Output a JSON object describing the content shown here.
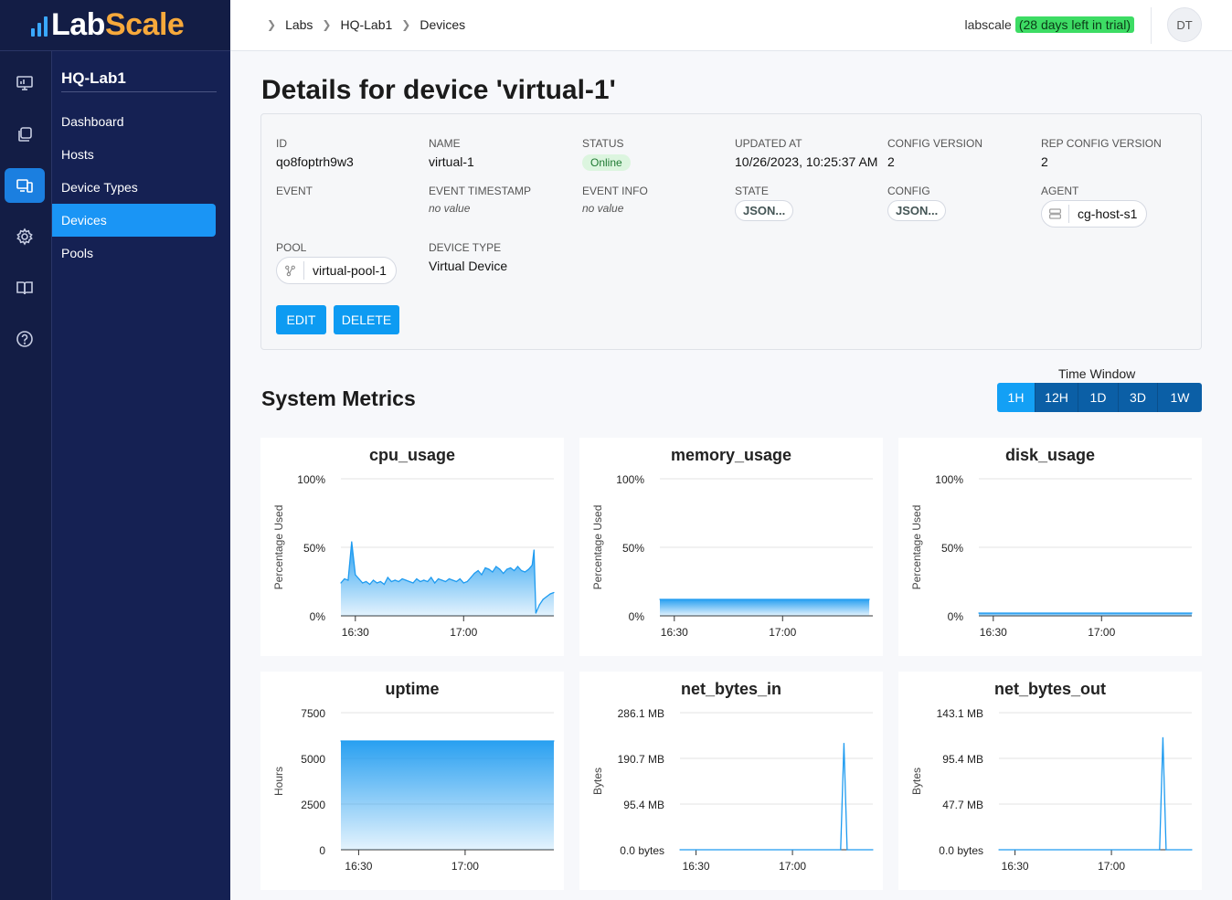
{
  "brand": {
    "name_part1": "Lab",
    "name_part2": "Scale",
    "accent": "#f7a93b",
    "primary": "#131d45"
  },
  "rail": {
    "icons": [
      "monitor-icon",
      "copy-icon",
      "devices-icon",
      "gear-icon",
      "book-icon",
      "help-icon"
    ],
    "active": "devices-icon"
  },
  "sidebar": {
    "title": "HQ-Lab1",
    "items": [
      {
        "label": "Dashboard"
      },
      {
        "label": "Hosts"
      },
      {
        "label": "Device Types"
      },
      {
        "label": "Devices",
        "active": true
      },
      {
        "label": "Pools"
      }
    ]
  },
  "header": {
    "breadcrumbs": [
      "Labs",
      "HQ-Lab1",
      "Devices"
    ],
    "account": "labscale",
    "trial_badge": "(28 days left in trial)",
    "avatar": "DT"
  },
  "page": {
    "title": "Details for device 'virtual-1'"
  },
  "details": {
    "id": {
      "label": "ID",
      "value": "qo8foptrh9w3"
    },
    "name": {
      "label": "NAME",
      "value": "virtual-1"
    },
    "status": {
      "label": "STATUS",
      "value": "Online"
    },
    "updated_at": {
      "label": "UPDATED AT",
      "value": "10/26/2023, 10:25:37 AM"
    },
    "config_version": {
      "label": "CONFIG VERSION",
      "value": "2"
    },
    "rep_config_version": {
      "label": "REP CONFIG VERSION",
      "value": "2"
    },
    "event": {
      "label": "EVENT"
    },
    "event_timestamp": {
      "label": "EVENT TIMESTAMP",
      "value": "no value"
    },
    "event_info": {
      "label": "EVENT INFO",
      "value": "no value"
    },
    "state": {
      "label": "STATE",
      "value": "JSON..."
    },
    "config": {
      "label": "CONFIG",
      "value": "JSON..."
    },
    "agent": {
      "label": "AGENT",
      "value": "cg-host-s1"
    },
    "pool": {
      "label": "POOL",
      "value": "virtual-pool-1"
    },
    "device_type": {
      "label": "DEVICE TYPE",
      "value": "Virtual Device"
    },
    "edit_label": "EDIT",
    "delete_label": "DELETE"
  },
  "metrics": {
    "title": "System Metrics",
    "time_window_label": "Time Window",
    "time_windows": [
      "1H",
      "12H",
      "1D",
      "3D",
      "1W"
    ],
    "active_window": "1H"
  },
  "chart_data": [
    {
      "type": "area",
      "title": "cpu_usage",
      "ylabel": "Percentage Used",
      "yticks": [
        "100%",
        "50%",
        "0%"
      ],
      "ylim": [
        0,
        100
      ],
      "xticks": [
        "16:30",
        "17:00"
      ],
      "xtick_minutes": [
        30,
        60
      ],
      "xlim": [
        26,
        85
      ],
      "x": [
        26,
        27,
        28,
        29,
        30,
        31,
        32,
        33,
        34,
        35,
        36,
        37,
        38,
        39,
        40,
        41,
        42,
        43,
        44,
        45,
        46,
        47,
        48,
        49,
        50,
        51,
        52,
        53,
        54,
        55,
        56,
        57,
        58,
        59,
        60,
        61,
        62,
        63,
        64,
        65,
        66,
        67,
        68,
        69,
        70,
        71,
        72,
        73,
        74,
        75,
        76,
        77,
        78,
        79,
        79.5,
        80,
        81,
        82,
        83,
        84,
        85
      ],
      "values": [
        24,
        27,
        26,
        54,
        30,
        27,
        24,
        25,
        23,
        26,
        24,
        25,
        23,
        28,
        25,
        26,
        25,
        27,
        26,
        25,
        24,
        27,
        25,
        26,
        25,
        28,
        24,
        27,
        26,
        25,
        27,
        26,
        25,
        27,
        24,
        25,
        28,
        31,
        33,
        30,
        35,
        34,
        32,
        36,
        34,
        31,
        34,
        35,
        33,
        36,
        33,
        32,
        34,
        37,
        48,
        2,
        8,
        12,
        14,
        16,
        17
      ]
    },
    {
      "type": "area",
      "title": "memory_usage",
      "ylabel": "Percentage Used",
      "yticks": [
        "100%",
        "50%",
        "0%"
      ],
      "ylim": [
        0,
        100
      ],
      "xticks": [
        "16:30",
        "17:00"
      ],
      "xtick_minutes": [
        30,
        60
      ],
      "xlim": [
        26,
        85
      ],
      "x": [
        26,
        84
      ],
      "values": [
        12,
        12
      ]
    },
    {
      "type": "area",
      "title": "disk_usage",
      "ylabel": "Percentage Used",
      "yticks": [
        "100%",
        "50%",
        "0%"
      ],
      "ylim": [
        0,
        100
      ],
      "xticks": [
        "16:30",
        "17:00"
      ],
      "xtick_minutes": [
        30,
        60
      ],
      "xlim": [
        26,
        85
      ],
      "x": [
        26,
        85
      ],
      "values": [
        2,
        2
      ]
    },
    {
      "type": "area",
      "title": "uptime",
      "ylabel": "Hours",
      "yticks": [
        "7500",
        "5000",
        "2500",
        "0"
      ],
      "ylim": [
        0,
        7500
      ],
      "xticks": [
        "16:30",
        "17:00"
      ],
      "xtick_minutes": [
        30,
        60
      ],
      "xlim": [
        25,
        85
      ],
      "x": [
        25,
        85
      ],
      "values": [
        5950,
        5950
      ]
    },
    {
      "type": "line",
      "title": "net_bytes_in",
      "ylabel": "Bytes",
      "yticks": [
        "286.1 MB",
        "190.7 MB",
        "95.4 MB",
        "0.0 bytes"
      ],
      "ylim": [
        0,
        286.1
      ],
      "xticks": [
        "16:30",
        "17:00"
      ],
      "xtick_minutes": [
        30,
        60
      ],
      "xlim": [
        25,
        85
      ],
      "x": [
        25,
        75,
        76,
        77,
        85
      ],
      "values": [
        0,
        0,
        222,
        0,
        0
      ]
    },
    {
      "type": "line",
      "title": "net_bytes_out",
      "ylabel": "Bytes",
      "yticks": [
        "143.1 MB",
        "95.4 MB",
        "47.7 MB",
        "0.0 bytes"
      ],
      "ylim": [
        0,
        143.1
      ],
      "xticks": [
        "16:30",
        "17:00"
      ],
      "xtick_minutes": [
        30,
        60
      ],
      "xlim": [
        25,
        85
      ],
      "x": [
        25,
        75,
        76,
        77,
        85
      ],
      "values": [
        0,
        0,
        117,
        0,
        0
      ]
    }
  ]
}
